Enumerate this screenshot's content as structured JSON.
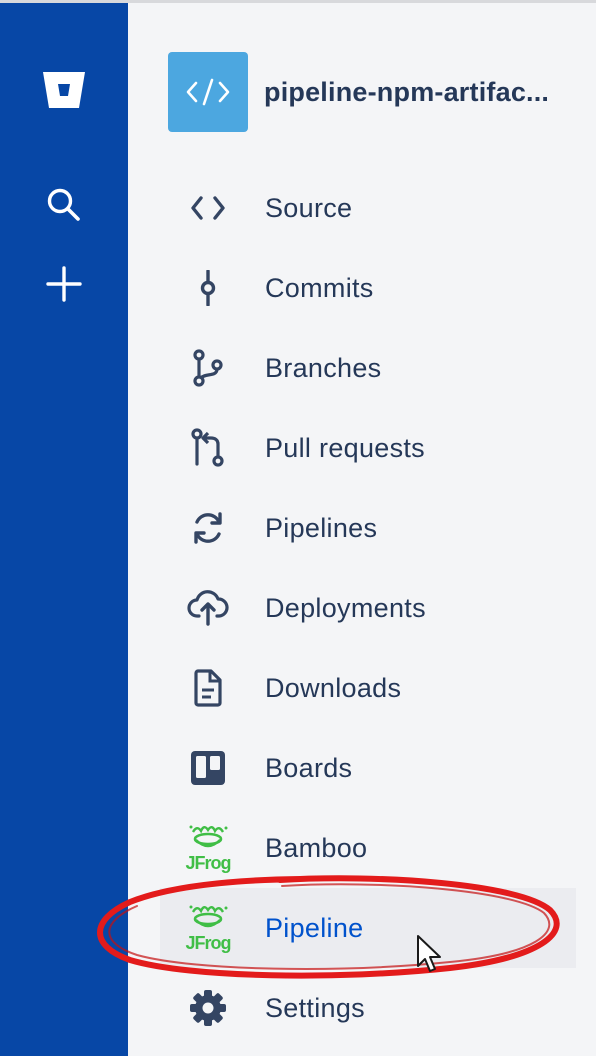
{
  "repo": {
    "name": "pipeline-npm-artifac..."
  },
  "global_nav": {
    "icons": [
      "bitbucket-logo",
      "search-icon",
      "plus-icon"
    ]
  },
  "sidebar": {
    "items": [
      {
        "label": "Source",
        "icon": "code-icon"
      },
      {
        "label": "Commits",
        "icon": "commit-icon"
      },
      {
        "label": "Branches",
        "icon": "branch-icon"
      },
      {
        "label": "Pull requests",
        "icon": "pull-request-icon"
      },
      {
        "label": "Pipelines",
        "icon": "refresh-icon"
      },
      {
        "label": "Deployments",
        "icon": "cloud-upload-icon"
      },
      {
        "label": "Downloads",
        "icon": "document-icon"
      },
      {
        "label": "Boards",
        "icon": "trello-board-icon"
      },
      {
        "label": "Bamboo",
        "icon": "jfrog-logo-icon"
      },
      {
        "label": "Pipeline",
        "icon": "jfrog-logo-icon",
        "selected": true
      },
      {
        "label": "Settings",
        "icon": "gear-icon"
      }
    ]
  },
  "logos": {
    "jfrog_text": "JFrog"
  },
  "colors": {
    "global_nav": "#0747a6",
    "sidebar_bg": "#f4f5f7",
    "text": "#253858",
    "selected_text": "#0052cc",
    "jfrog_green": "#40be46",
    "annotation_red": "#e31b1b"
  }
}
